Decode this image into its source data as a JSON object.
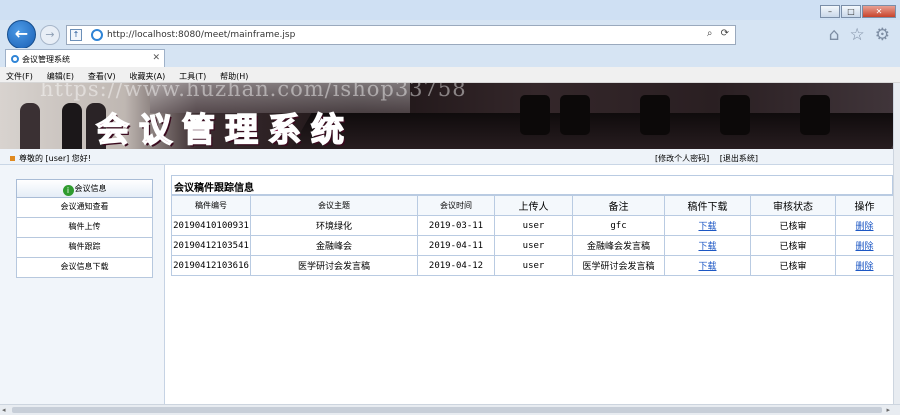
{
  "window": {
    "minimize_label": "–",
    "maximize_label": "□",
    "close_label": "✕"
  },
  "browser": {
    "url": "http://localhost:8080/meet/mainframe.jsp",
    "tab_title": "会议管理系统",
    "menu": [
      "文件(F)",
      "编辑(E)",
      "查看(V)",
      "收藏夹(A)",
      "工具(T)",
      "帮助(H)"
    ],
    "tools": {
      "refresh": "⟳",
      "search": "⌕"
    },
    "icons": {
      "home": "⌂",
      "favorites": "☆",
      "settings": "⚙"
    }
  },
  "banner": {
    "logo_text": "会议管理系统",
    "watermark": "https://www.huzhan.com/ishop33758"
  },
  "status": {
    "greeting": "尊敬的 [user] 您好!",
    "links": [
      "[修改个人密码]",
      "[退出系统]"
    ]
  },
  "sidebar": {
    "header": "会议信息",
    "items": [
      "会议通知查看",
      "稿件上传",
      "稿件跟踪",
      "会议信息下载"
    ]
  },
  "main": {
    "title": "会议稿件跟踪信息",
    "columns": [
      "稿件编号",
      "会议主题",
      "会议时间",
      "上传人",
      "备注",
      "稿件下载",
      "审核状态",
      "操作"
    ],
    "rows": [
      {
        "id": "20190410100931",
        "topic": "环境绿化",
        "date": "2019-03-11",
        "uploader": "user",
        "note": "gfc",
        "download": "下载",
        "status": "已核审",
        "action": "删除"
      },
      {
        "id": "20190412103541",
        "topic": "金融峰会",
        "date": "2019-04-11",
        "uploader": "user",
        "note": "金融峰会发言稿",
        "download": "下载",
        "status": "已核审",
        "action": "删除"
      },
      {
        "id": "20190412103616",
        "topic": "医学研讨会发言稿",
        "date": "2019-04-12",
        "uploader": "user",
        "note": "医学研讨会发言稿",
        "download": "下载",
        "status": "已核审",
        "action": "删除"
      }
    ]
  }
}
